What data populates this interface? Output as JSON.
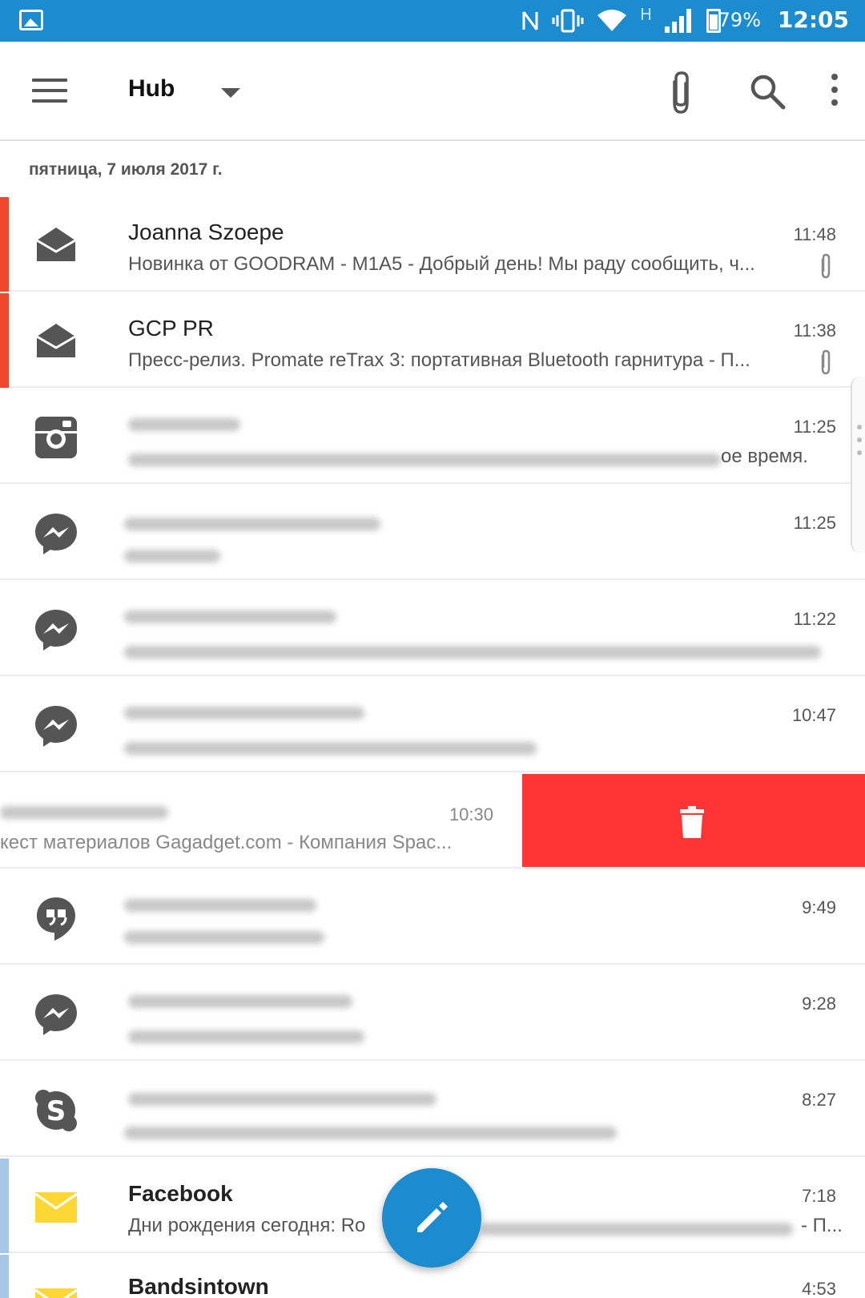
{
  "status_bar": {
    "network_type": "H",
    "battery_percent": "79%",
    "time": "12:05"
  },
  "app_bar": {
    "title": "Hub"
  },
  "date_header": "пятница, 7 июля 2017 г.",
  "messages": [
    {
      "sender": "Joanna Szoepe",
      "time": "11:48",
      "preview": "Новинка от GOODRAM - M1A5  - Добрый день! Мы раду сообщить, ч...",
      "icon": "open-envelope-icon",
      "accent": "#f0472f",
      "attachment": true
    },
    {
      "sender": "GCP PR",
      "time": "11:38",
      "preview": "Пресс-релиз. Promate reTrax 3: портативная Bluetooth гарнитура - П...",
      "icon": "open-envelope-icon",
      "accent": "#f0472f",
      "attachment": true
    },
    {
      "sender": "",
      "time": "11:25",
      "preview_tail": "ое время.",
      "icon": "instagram-icon"
    },
    {
      "sender": "",
      "time": "11:25",
      "icon": "messenger-icon"
    },
    {
      "sender": "",
      "time": "11:22",
      "icon": "messenger-icon"
    },
    {
      "sender": "",
      "time": "10:47",
      "icon": "messenger-icon"
    },
    {
      "sender": "",
      "time": "10:30",
      "preview": "кест материалов Gagadget.com - Компания Spac...",
      "swiped": true
    },
    {
      "sender": "",
      "time": "9:49",
      "icon": "hangouts-icon"
    },
    {
      "sender": "",
      "time": "9:28",
      "icon": "messenger-icon"
    },
    {
      "sender": "",
      "time": "8:27",
      "icon": "skype-icon"
    },
    {
      "sender": "Facebook",
      "time": "7:18",
      "preview_start": "Дни рождения сегодня: Ro",
      "preview_end": "- П...",
      "icon": "envelope-icon",
      "accent": "#a8c7e8"
    },
    {
      "sender": "Bandsintown",
      "time": "4:53",
      "icon": "envelope-icon",
      "accent": "#a8c7e8"
    }
  ],
  "colors": {
    "primary": "#1a8ccf",
    "delete": "#ff3434",
    "unread_accent": "#f0472f",
    "read_accent": "#a8c7e8",
    "envelope_yellow": "#fdd835",
    "icon_gray": "#555555"
  }
}
